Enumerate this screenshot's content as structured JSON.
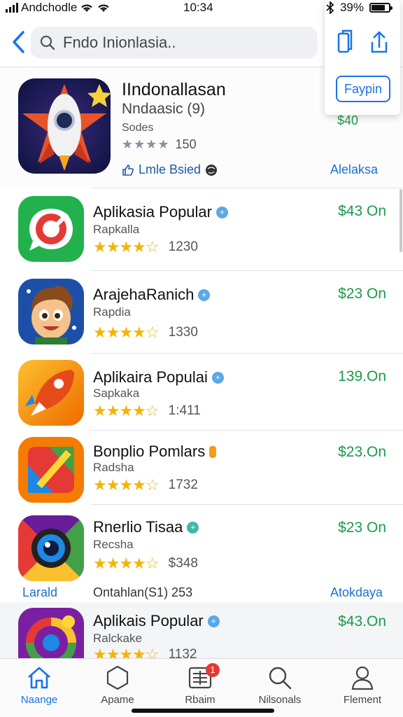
{
  "status_bar": {
    "carrier": "Andchodle",
    "time": "10:34",
    "battery": "39%"
  },
  "search": {
    "placeholder": "Fndo Inionlasia.."
  },
  "popup": {
    "button_label": "Faypin"
  },
  "featured": {
    "title": "IIndonallasan",
    "subtitle": "Nndaasic (9)",
    "developer": "Sodes",
    "stars": "★★★★",
    "rating_count": "150",
    "price": "$40",
    "badge": "Lmle Bsied",
    "action": "Alelaksa"
  },
  "apps": [
    {
      "name": "Aplikasia Popular",
      "developer": "Rapkalla",
      "stars": "★★★★☆",
      "rating_count": "1230",
      "price": "$43 On"
    },
    {
      "name": "ArajehaRanich",
      "developer": "Rapdia",
      "stars": "★★★★☆",
      "rating_count": "1330",
      "price": "$23 On"
    },
    {
      "name": "Aplikaira Populai",
      "developer": "Sapkaka",
      "stars": "★★★★☆",
      "rating_count": "1:411",
      "price": "139.On"
    },
    {
      "name": "Bonplio Pomlars",
      "developer": "Radsha",
      "stars": "★★★★☆",
      "rating_count": "1732",
      "price": "$23.On"
    },
    {
      "name": "Rnerlio Tisaa",
      "developer": "Recsha",
      "stars": "★★★★☆",
      "rating_count": "$348",
      "price": "$23 On"
    },
    {
      "name": "Aplikais Popular",
      "developer": "Ralckake",
      "stars": "★★★★☆",
      "rating_count": "1132",
      "price": "$43.On"
    }
  ],
  "extra_row": {
    "left": "Larald",
    "middle": "Ontahlan(S1) 253",
    "right": "Atokdaya"
  },
  "tabs": [
    {
      "label": "Naange",
      "icon": "home-icon"
    },
    {
      "label": "Apame",
      "icon": "hexagon-icon"
    },
    {
      "label": "Rbaim",
      "icon": "list-icon",
      "badge": "1"
    },
    {
      "label": "Nilsonals",
      "icon": "search-icon"
    },
    {
      "label": "Flement",
      "icon": "person-icon"
    }
  ],
  "colors": {
    "accent": "#1a73e8",
    "price_green": "#1a9a4a",
    "star_gold": "#f4b400",
    "badge_red": "#e53935"
  }
}
